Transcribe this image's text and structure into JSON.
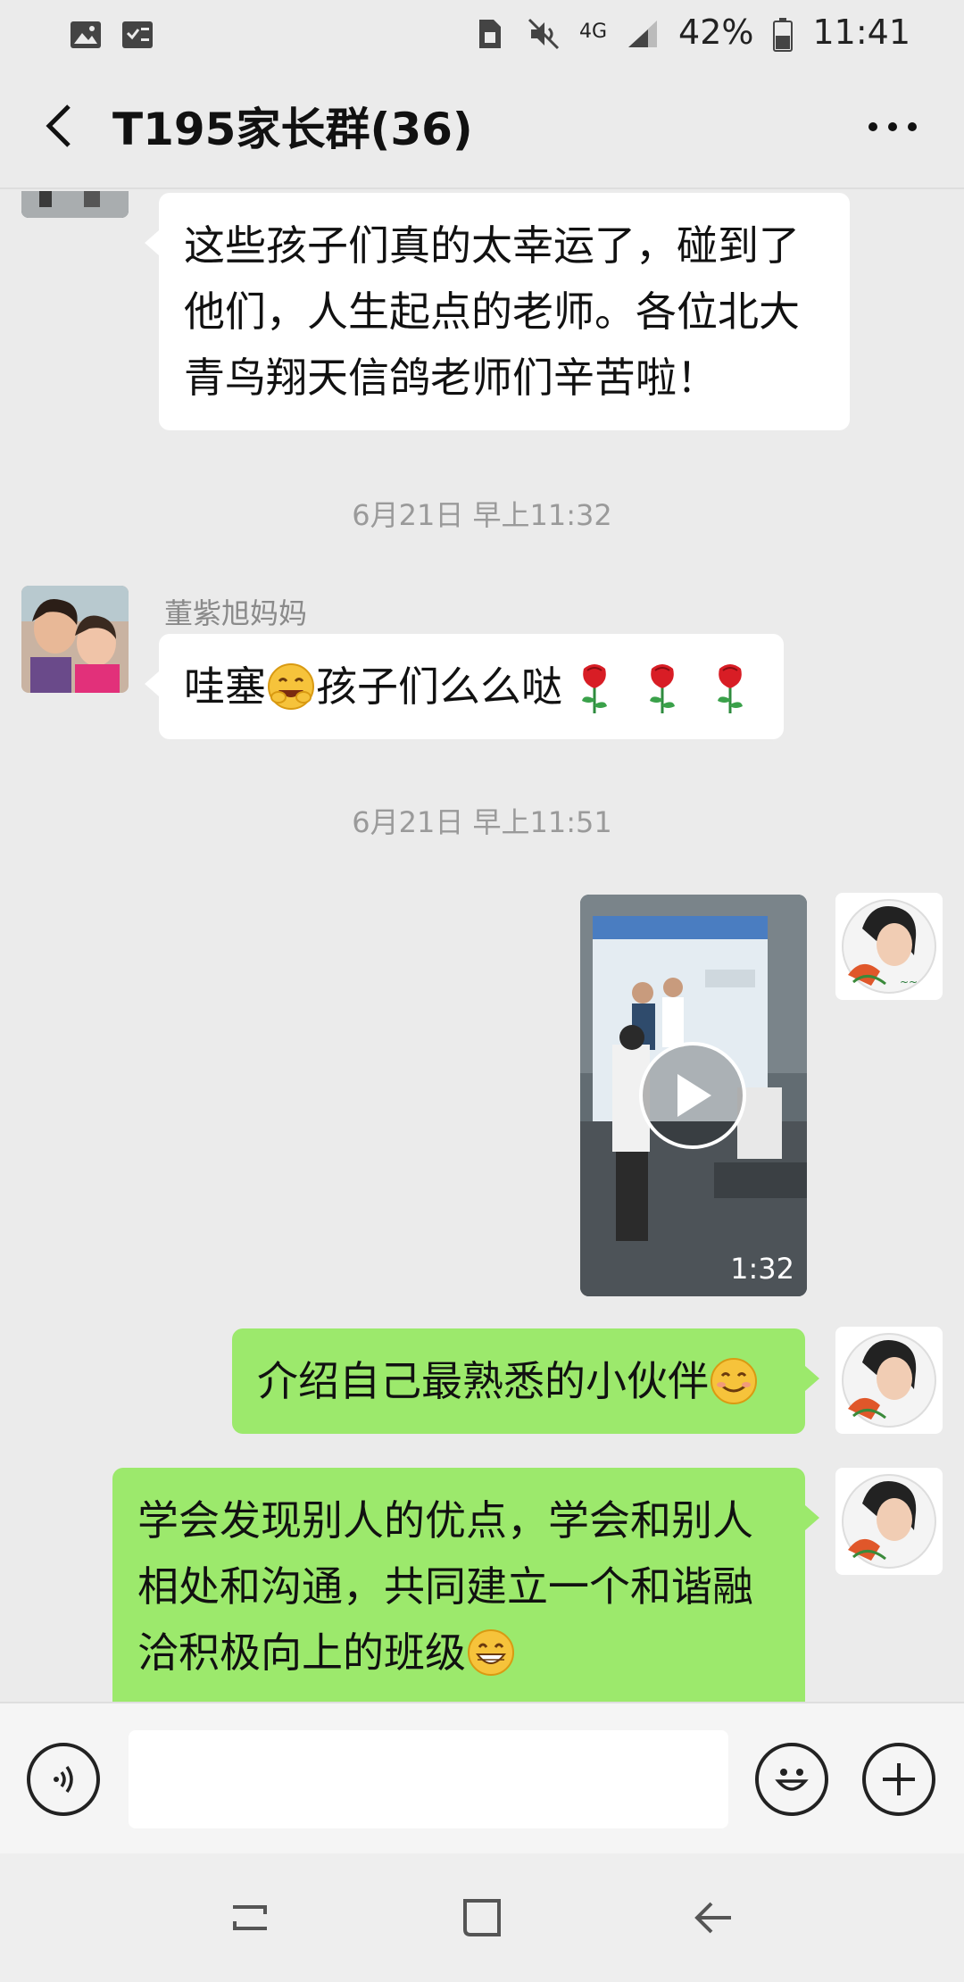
{
  "status_bar": {
    "battery": "42%",
    "time": "11:41",
    "network": "4G"
  },
  "header": {
    "title": "T195家长群(36)"
  },
  "messages": [
    {
      "type": "text",
      "side": "left",
      "lines": [
        "这些孩子们真的太幸运了，碰到了",
        "他们，人生起点的老师。各位北大",
        "青鸟翔天信鸽老师们辛苦啦！"
      ]
    },
    {
      "type": "timestamp",
      "text": "6月21日 早上11:32"
    },
    {
      "type": "text",
      "side": "left",
      "sender": "董紫旭妈妈",
      "text_before_emoji": "哇塞",
      "text_after_emoji": "孩子们么么哒"
    },
    {
      "type": "timestamp",
      "text": "6月21日 早上11:51"
    },
    {
      "type": "video",
      "side": "right",
      "duration": "1:32"
    },
    {
      "type": "text",
      "side": "right",
      "text": "介绍自己最熟悉的小伙伴"
    },
    {
      "type": "text",
      "side": "right",
      "lines": [
        "学会发现别人的优点，学会和别人",
        "相处和沟通，共同建立一个和谐融",
        "洽积极向上的班级"
      ]
    }
  ],
  "colors": {
    "background": "#ebebeb",
    "bubble_incoming": "#ffffff",
    "bubble_outgoing": "#9ce96c"
  },
  "icons": {
    "back": "chevron-left-icon",
    "more": "more-icon",
    "voice": "voice-icon",
    "emoji": "emoji-icon",
    "plus": "plus-icon"
  }
}
